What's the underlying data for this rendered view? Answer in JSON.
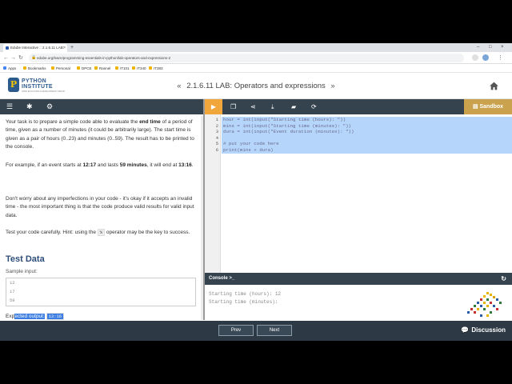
{
  "browser": {
    "tab_title": "Edube Interactive :: 2.1.6.11 LAB:",
    "url": "edube.org/learn/programming-essentials-in-python/lab-operators-and-expressions-2",
    "bookmarks": [
      "Apps",
      "Bookmarks",
      "Personal",
      "DPCE",
      "Rannel",
      "IT101",
      "IT340",
      "IT383"
    ]
  },
  "header": {
    "logo_title_line1": "PYTHON",
    "logo_title_line2": "INSTITUTE",
    "logo_sub": "OPEN EDUCATION & DEVELOPMENT GROUP",
    "title": "2.1.6.11 LAB: Operators and expressions",
    "prev_arrow": "«",
    "next_arrow": "»"
  },
  "instructions": {
    "p1_a": "Your task is to prepare a simple code able to evaluate the ",
    "p1_b": "end time",
    "p1_c": " of a period of time, given as a number of minutes (it could be arbitrarily large). The start time is given as a pair of hours (0..23) and minutes (0..59). The result has to be printed to the console.",
    "p2_a": "For example, if an event starts at ",
    "p2_b": "12:17",
    "p2_c": " and lasts ",
    "p2_d": "59 minutes",
    "p2_e": ", it will end at ",
    "p2_f": "13:16",
    "p2_g": ".",
    "p3": "Don't worry about any imperfections in your code - it's okay if it accepts an invalid time - the most important thing is that the code produce valid results for valid input data.",
    "p4_a": "Test your code carefully. Hint: using the ",
    "p4_code": "%",
    "p4_b": " operator may be the key to success.",
    "test_heading": "Test Data",
    "sample_label": "Sample input:",
    "sample_lines": [
      "12",
      "17",
      "59"
    ],
    "expected_label_a": "Exp",
    "expected_label_b": "ected output:",
    "expected_value": "13:16"
  },
  "editor": {
    "sandbox_label": "Sandbox",
    "line_numbers": [
      "1",
      "2",
      "3",
      "4",
      "5",
      "6"
    ],
    "lines": [
      "hour = int(input(\"Starting time (hours): \"))",
      "mins = int(input(\"Starting time (minutes): \"))",
      "dura = int(input(\"Event duration (minutes): \"))",
      "",
      "# put your code here",
      "print(mins + dura)"
    ]
  },
  "console": {
    "title": "Console >_",
    "lines": [
      "Starting time (hours): 12",
      "Starting time (minutes):"
    ]
  },
  "footer": {
    "prev_label": "Prev",
    "next_label": "Next",
    "discussion_label": "Discussion"
  },
  "colors": {
    "toolbar": "#35434f",
    "run_button": "#f0a63a",
    "sandbox": "#caa24e",
    "footer": "#2d3944",
    "heading": "#2d4e7a"
  }
}
